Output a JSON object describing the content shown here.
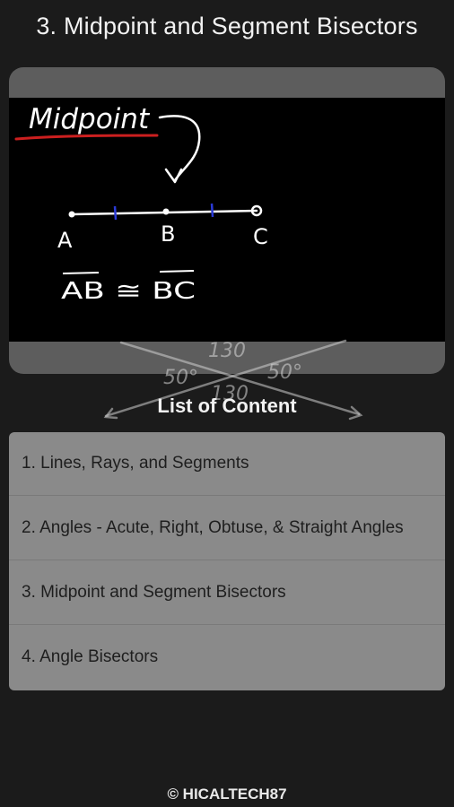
{
  "header": {
    "title": "3.  Midpoint and Segment Bisectors"
  },
  "video": {
    "whiteboard_text": {
      "heading": "Midpoint",
      "points": [
        "A",
        "B",
        "C"
      ],
      "congruence": "AB ≅ BC"
    }
  },
  "background_sketch": {
    "angle_labels": [
      "130",
      "50°",
      "50°",
      "130"
    ]
  },
  "contents": {
    "heading": "List of Content",
    "items": [
      {
        "label": "1.  Lines, Rays, and Segments"
      },
      {
        "label": "2.  Angles - Acute, Right, Obtuse, & Straight Angles"
      },
      {
        "label": "3.  Midpoint and Segment Bisectors"
      },
      {
        "label": "4.  Angle Bisectors"
      }
    ]
  },
  "footer": {
    "copyright": "© HICALTECH87"
  },
  "colors": {
    "background": "#1b1b1b",
    "card": "#5d5d5d",
    "list": "#8a8a8a",
    "underline": "#cc1f1f",
    "tick_marks": "#2a3ad6"
  }
}
